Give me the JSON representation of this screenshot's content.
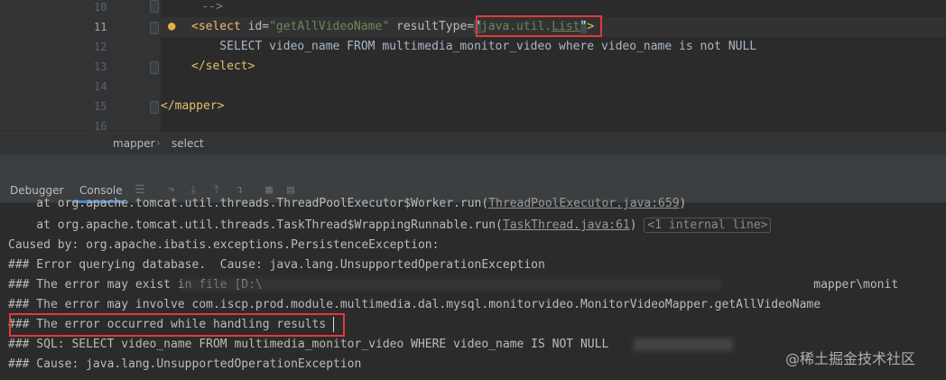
{
  "editor": {
    "lines": [
      {
        "num": "10",
        "text": "   -->"
      },
      {
        "num": "11",
        "text": "<select id=\"getAllVideoName\" resultType=\"java.util.List\">"
      },
      {
        "num": "12",
        "text": "    SELECT video_name FROM multimedia_monitor_video where video_name is not NULL"
      },
      {
        "num": "13",
        "text": "</select>"
      },
      {
        "num": "14",
        "text": ""
      },
      {
        "num": "15",
        "text": "</mapper>"
      },
      {
        "num": "16",
        "text": ""
      }
    ],
    "line11_parts": {
      "open": "<select",
      "id_attr": " id=",
      "id_val": "\"getAllVideoName\"",
      "rt_attr": " resultType=",
      "q1": "\"",
      "rt_val_a": "java.util.",
      "rt_val_b": "List",
      "q2": "\"",
      "close": ">"
    }
  },
  "breadcrumb": {
    "item1": "mapper",
    "item2": "select"
  },
  "tool_window": {
    "tab_debugger": "Debugger",
    "tab_console": "Console"
  },
  "console": {
    "line0_a": "    at org.apache.tomcat.util.threads.ThreadPoolExecutor$Worker.run(",
    "line0_link": "ThreadPoolExecutor.java:659",
    "line0_b": ")",
    "line1_a": "    at org.apache.tomcat.util.threads.TaskThread$WrappingRunnable.run(",
    "line1_link": "TaskThread.java:61",
    "line1_b": ")",
    "line1_pill": "<1 internal line>",
    "line2": "Caused by: org.apache.ibatis.exceptions.PersistenceException:",
    "line3": "### Error querying database.  Cause: java.lang.UnsupportedOperationException",
    "line4": "### The error may exist in file [D:\\                                                                              mapper\\monit",
    "line5": "### The error may involve com.iscp.prod.module.multimedia.dal.mysql.monitorvideo.MonitorVideoMapper.getAllVideoName",
    "line6": "### The error occurred while handling results",
    "line7": "### SQL: SELECT video_name FROM multimedia_monitor_video WHERE video_name IS NOT NULL",
    "line8": "### Cause: java.lang.UnsupportedOperationException"
  },
  "watermark": "@稀土掘金技术社区",
  "colors": {
    "accent_red": "#e03a3a",
    "tab_underline": "#4a88c7"
  }
}
